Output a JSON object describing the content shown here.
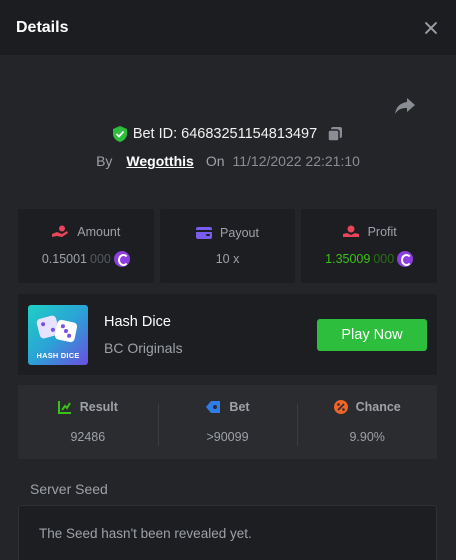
{
  "header": {
    "title": "Details"
  },
  "bet": {
    "id_label": "Bet ID: 64683251154813497",
    "by_label": "By",
    "user": "Wegotthis",
    "on_label": "On",
    "date": "11/12/2022 22:21:10"
  },
  "stats": {
    "amount": {
      "label": "Amount",
      "value_main": "0.15001",
      "value_dim": "000"
    },
    "payout": {
      "label": "Payout",
      "value": "10 x"
    },
    "profit": {
      "label": "Profit",
      "value_main": "1.35009",
      "value_dim": "000"
    }
  },
  "game": {
    "thumb_text": "HASH DICE",
    "name": "Hash Dice",
    "provider": "BC Originals",
    "play_label": "Play Now"
  },
  "results": {
    "result": {
      "label": "Result",
      "value": "92486"
    },
    "bet": {
      "label": "Bet",
      "value": ">90099"
    },
    "chance": {
      "label": "Chance",
      "value": "9.90%"
    }
  },
  "seed": {
    "title": "Server Seed",
    "message": "The Seed hasn't been revealed yet."
  },
  "colors": {
    "accent_green": "#2cbe3c",
    "profit_green": "#3bc117",
    "coin_purple": "#8b3fe0",
    "amount_icon": "#e8455a",
    "payout_icon": "#7a5cf0",
    "profit_icon": "#e8455a",
    "result_icon": "#3bc117",
    "bet_icon": "#2f7de8",
    "chance_icon": "#f0642a"
  },
  "icons": {
    "close": "close-icon",
    "share": "share-icon",
    "verified": "shield-check-icon",
    "copy": "copy-icon",
    "amount": "hand-coin-icon",
    "payout": "wallet-icon",
    "profit": "profit-hand-icon",
    "currency": "coin-icon",
    "result": "chart-result-icon",
    "bet": "tag-icon",
    "chance": "percent-icon"
  }
}
